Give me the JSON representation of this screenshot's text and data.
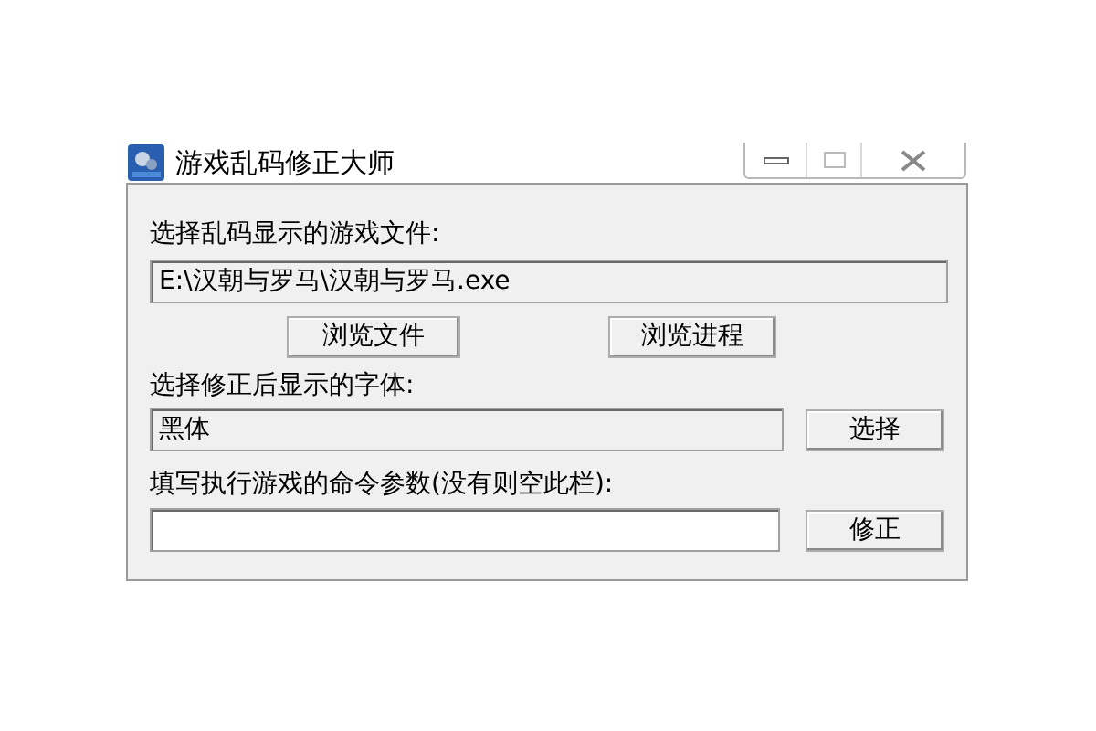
{
  "window": {
    "title": "游戏乱码修正大师"
  },
  "file_label": "选择乱码显示的游戏文件:",
  "file_field": {
    "value": "E:\\汉朝与罗马\\汉朝与罗马.exe",
    "readonly": true
  },
  "file_buttons": [
    "浏览文件",
    "浏览进程"
  ],
  "font_label": "选择修正后显示的字体:",
  "font_field": {
    "value": "黑体",
    "readonly": true
  },
  "font_button": "选择",
  "args_label": "填写执行游戏的命令参数(没有则空此栏):",
  "args_field": {
    "readonly": false
  },
  "fix_button": "修正"
}
